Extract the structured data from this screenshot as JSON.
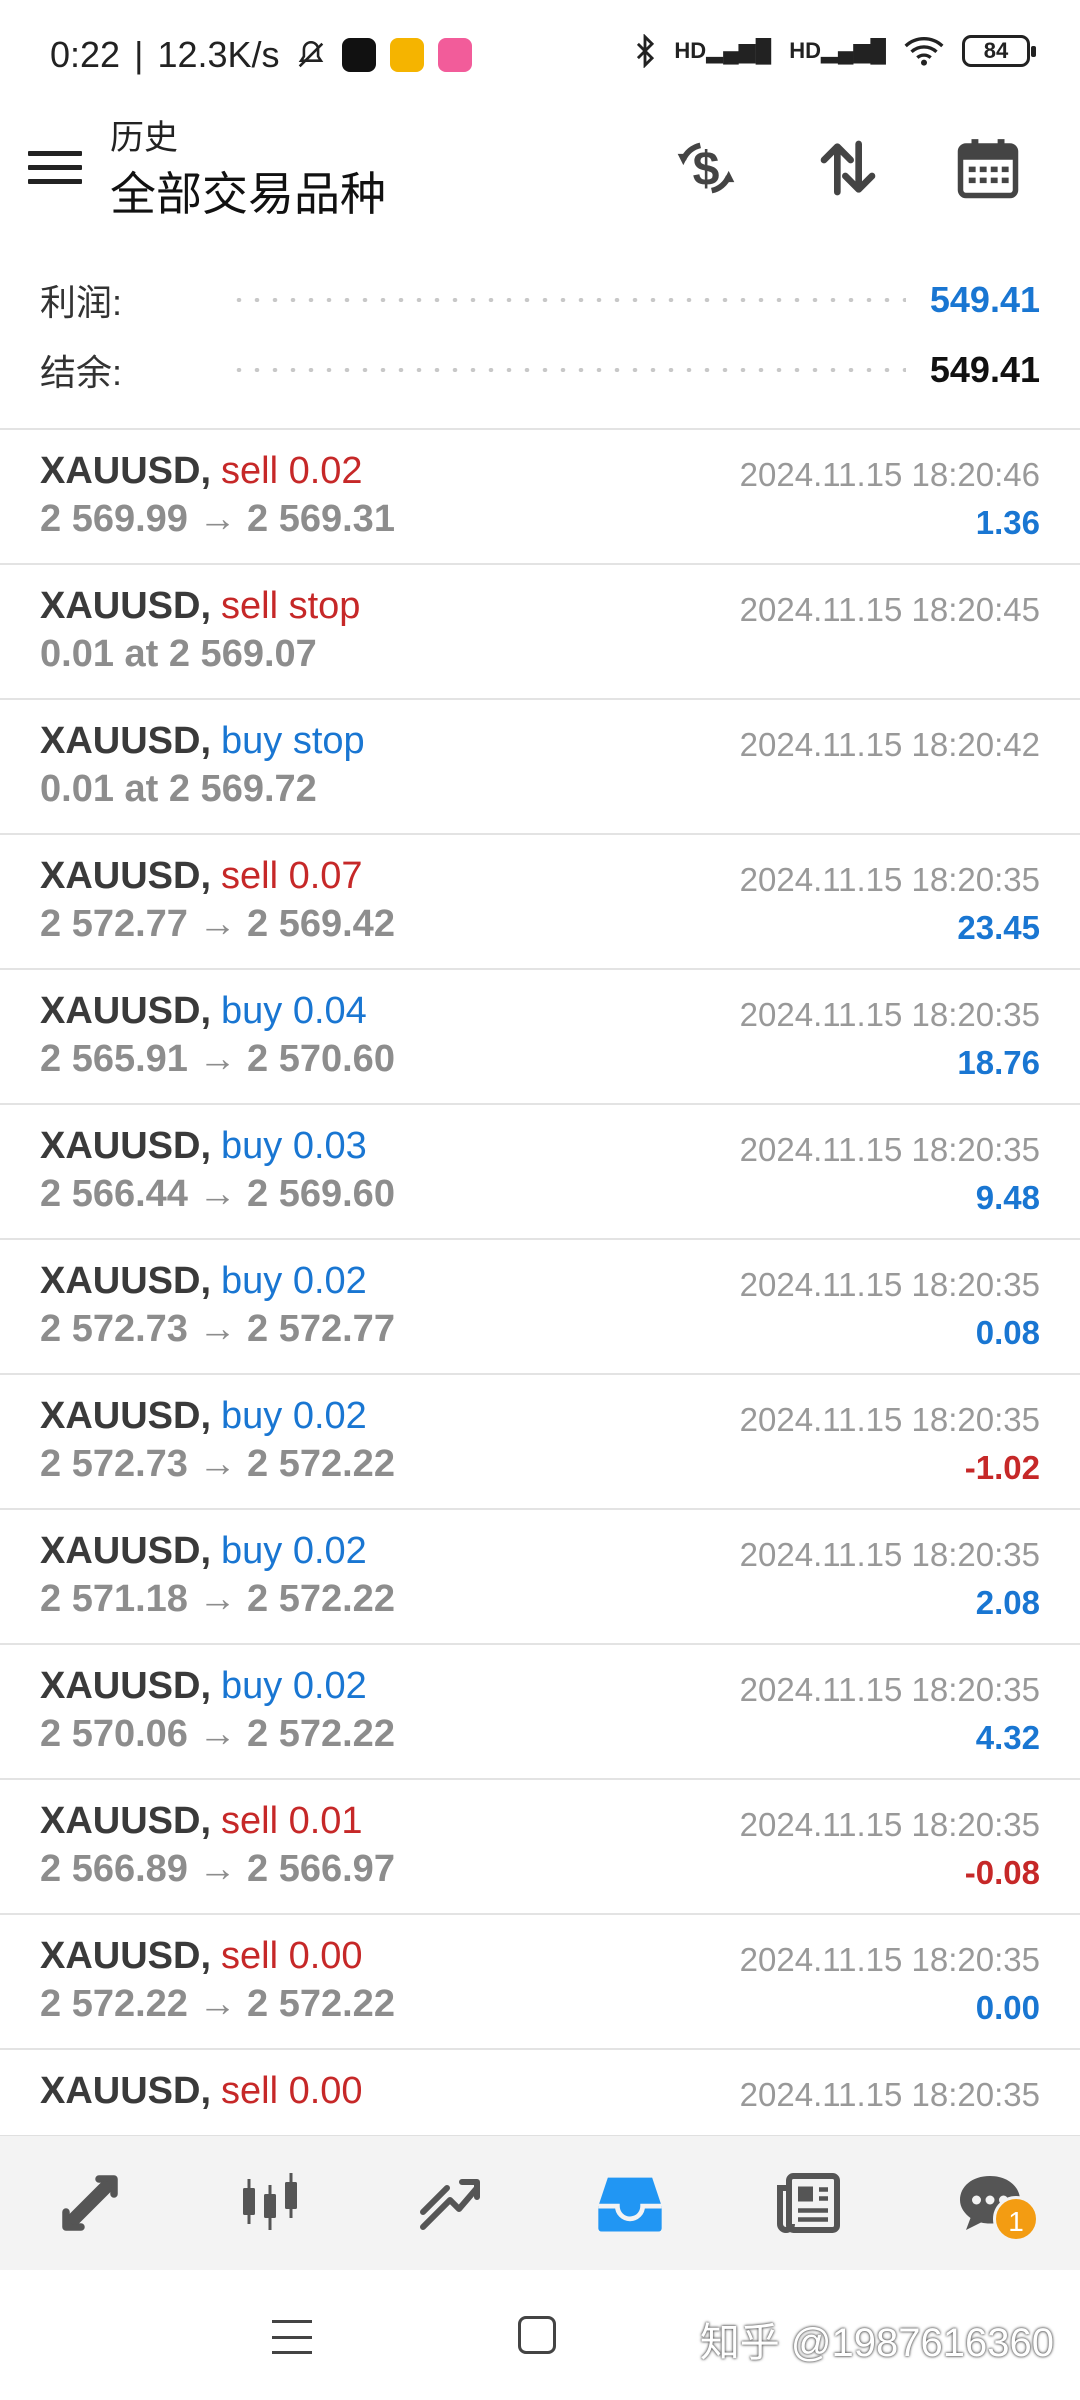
{
  "status_bar": {
    "time": "0:22",
    "net_speed": "12.3K/s",
    "signal1": "HD",
    "signal2": "HD",
    "battery": "84"
  },
  "appbar": {
    "subtitle": "历史",
    "title": "全部交易品种"
  },
  "summary": {
    "profit_label": "利润:",
    "profit_value": "549.41",
    "balance_label": "结余:",
    "balance_value": "549.41"
  },
  "colors": {
    "sell": "#c62828",
    "buy": "#1976d2",
    "positive": "#1976d2",
    "negative": "#c62828",
    "accent": "#2196f3"
  },
  "deals": [
    {
      "symbol": "XAUUSD",
      "type": "sell 0.02",
      "side": "sell",
      "prices": "2 569.99 → 2 569.31",
      "time": "2024.11.15 18:20:46",
      "profit": "1.36",
      "sign": "positive"
    },
    {
      "symbol": "XAUUSD",
      "type": "sell stop",
      "side": "sell",
      "prices": "0.01 at 2 569.07",
      "time": "2024.11.15 18:20:45",
      "profit": "",
      "sign": "positive"
    },
    {
      "symbol": "XAUUSD",
      "type": "buy stop",
      "side": "buy",
      "prices": "0.01 at 2 569.72",
      "time": "2024.11.15 18:20:42",
      "profit": "",
      "sign": "positive"
    },
    {
      "symbol": "XAUUSD",
      "type": "sell 0.07",
      "side": "sell",
      "prices": "2 572.77 → 2 569.42",
      "time": "2024.11.15 18:20:35",
      "profit": "23.45",
      "sign": "positive"
    },
    {
      "symbol": "XAUUSD",
      "type": "buy 0.04",
      "side": "buy",
      "prices": "2 565.91 → 2 570.60",
      "time": "2024.11.15 18:20:35",
      "profit": "18.76",
      "sign": "positive"
    },
    {
      "symbol": "XAUUSD",
      "type": "buy 0.03",
      "side": "buy",
      "prices": "2 566.44 → 2 569.60",
      "time": "2024.11.15 18:20:35",
      "profit": "9.48",
      "sign": "positive"
    },
    {
      "symbol": "XAUUSD",
      "type": "buy 0.02",
      "side": "buy",
      "prices": "2 572.73 → 2 572.77",
      "time": "2024.11.15 18:20:35",
      "profit": "0.08",
      "sign": "positive"
    },
    {
      "symbol": "XAUUSD",
      "type": "buy 0.02",
      "side": "buy",
      "prices": "2 572.73 → 2 572.22",
      "time": "2024.11.15 18:20:35",
      "profit": "-1.02",
      "sign": "negative"
    },
    {
      "symbol": "XAUUSD",
      "type": "buy 0.02",
      "side": "buy",
      "prices": "2 571.18 → 2 572.22",
      "time": "2024.11.15 18:20:35",
      "profit": "2.08",
      "sign": "positive"
    },
    {
      "symbol": "XAUUSD",
      "type": "buy 0.02",
      "side": "buy",
      "prices": "2 570.06 → 2 572.22",
      "time": "2024.11.15 18:20:35",
      "profit": "4.32",
      "sign": "positive"
    },
    {
      "symbol": "XAUUSD",
      "type": "sell 0.01",
      "side": "sell",
      "prices": "2 566.89 → 2 566.97",
      "time": "2024.11.15 18:20:35",
      "profit": "-0.08",
      "sign": "negative"
    },
    {
      "symbol": "XAUUSD",
      "type": "sell 0.00",
      "side": "sell",
      "prices": "2 572.22 → 2 572.22",
      "time": "2024.11.15 18:20:35",
      "profit": "0.00",
      "sign": "positive"
    },
    {
      "symbol": "XAUUSD",
      "type": "sell 0.00",
      "side": "sell",
      "prices": "",
      "time": "2024.11.15 18:20:35",
      "profit": "",
      "sign": "positive"
    }
  ],
  "bottom_nav": {
    "items": [
      "quotes-icon",
      "chart-icon",
      "trade-icon",
      "history-icon",
      "news-icon",
      "chat-icon"
    ],
    "active": "history-icon",
    "chat_badge": "1"
  },
  "watermark": "知乎 @1987616360"
}
